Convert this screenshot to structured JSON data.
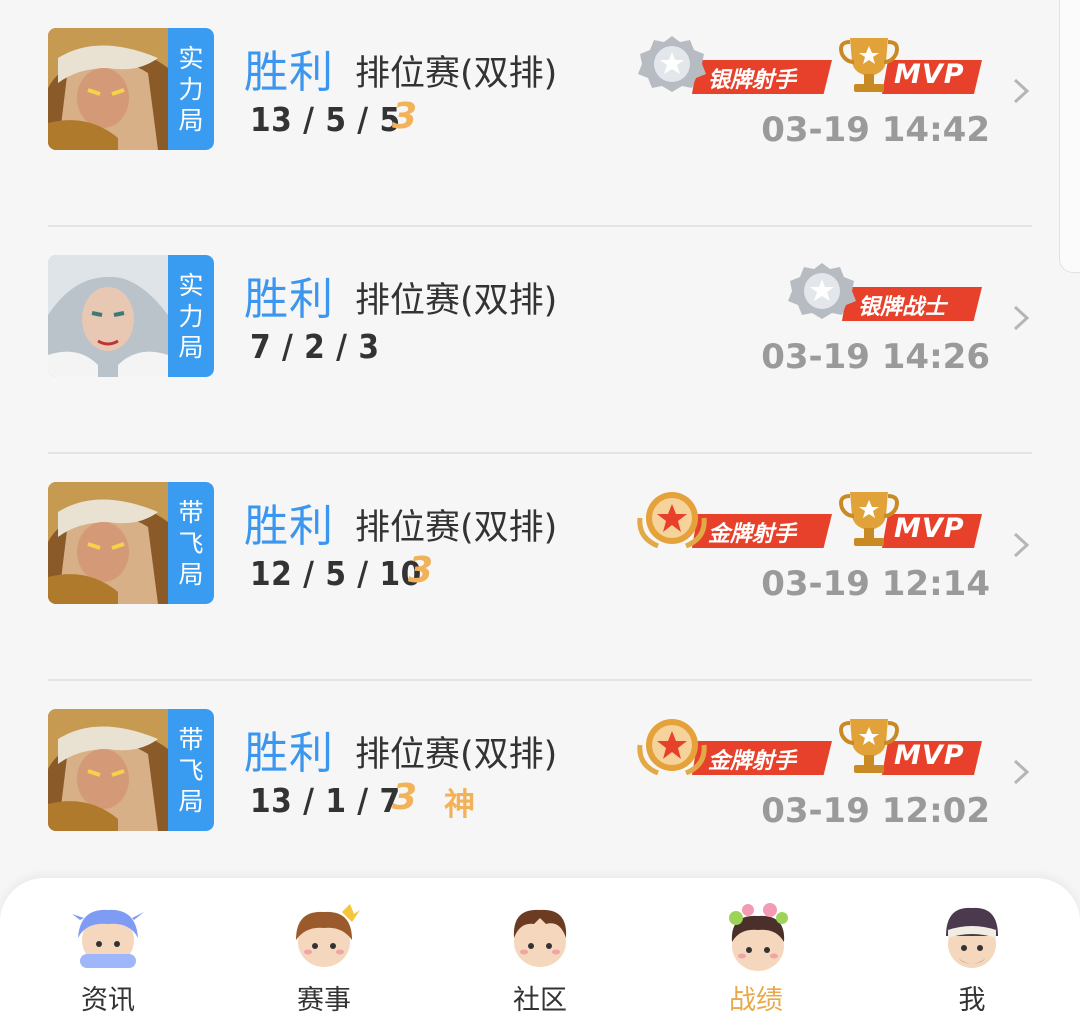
{
  "matches": [
    {
      "mode_badge": [
        "实",
        "力",
        "局"
      ],
      "result": "胜利",
      "mode": "排位赛(双排)",
      "kda": "13 / 5 / 5",
      "triple_kill": "3",
      "legendary": "",
      "honor_badge": "银牌射手",
      "honor_tier": "silver",
      "mvp": "MVP",
      "time": "03-19 14:42",
      "hero": "gold"
    },
    {
      "mode_badge": [
        "实",
        "力",
        "局"
      ],
      "result": "胜利",
      "mode": "排位赛(双排)",
      "kda": "7 / 2 / 3",
      "triple_kill": "",
      "legendary": "",
      "honor_badge": "银牌战士",
      "honor_tier": "silver",
      "mvp": "",
      "time": "03-19 14:26",
      "hero": "silver"
    },
    {
      "mode_badge": [
        "带",
        "飞",
        "局"
      ],
      "result": "胜利",
      "mode": "排位赛(双排)",
      "kda": "12 / 5 / 10",
      "triple_kill": "3",
      "legendary": "",
      "honor_badge": "金牌射手",
      "honor_tier": "gold",
      "mvp": "MVP",
      "time": "03-19 12:14",
      "hero": "gold"
    },
    {
      "mode_badge": [
        "带",
        "飞",
        "局"
      ],
      "result": "胜利",
      "mode": "排位赛(双排)",
      "kda": "13 / 1 / 7",
      "triple_kill": "3",
      "legendary": "神",
      "honor_badge": "金牌射手",
      "honor_tier": "gold",
      "mvp": "MVP",
      "time": "03-19 12:02",
      "hero": "gold"
    }
  ],
  "tabbar": {
    "active": 3,
    "items": [
      {
        "label": "资讯",
        "icon": "news-avatar-icon"
      },
      {
        "label": "赛事",
        "icon": "tournament-avatar-icon"
      },
      {
        "label": "社区",
        "icon": "community-avatar-icon"
      },
      {
        "label": "战绩",
        "icon": "record-avatar-icon"
      },
      {
        "label": "我",
        "icon": "me-avatar-icon"
      }
    ]
  },
  "colors": {
    "victory_blue": "#3a96ee",
    "badge_blue": "#3a9cf1",
    "ribbon_red": "#e8412b",
    "active_tab": "#e9a948",
    "gold_numeral": "#f2b25a"
  }
}
